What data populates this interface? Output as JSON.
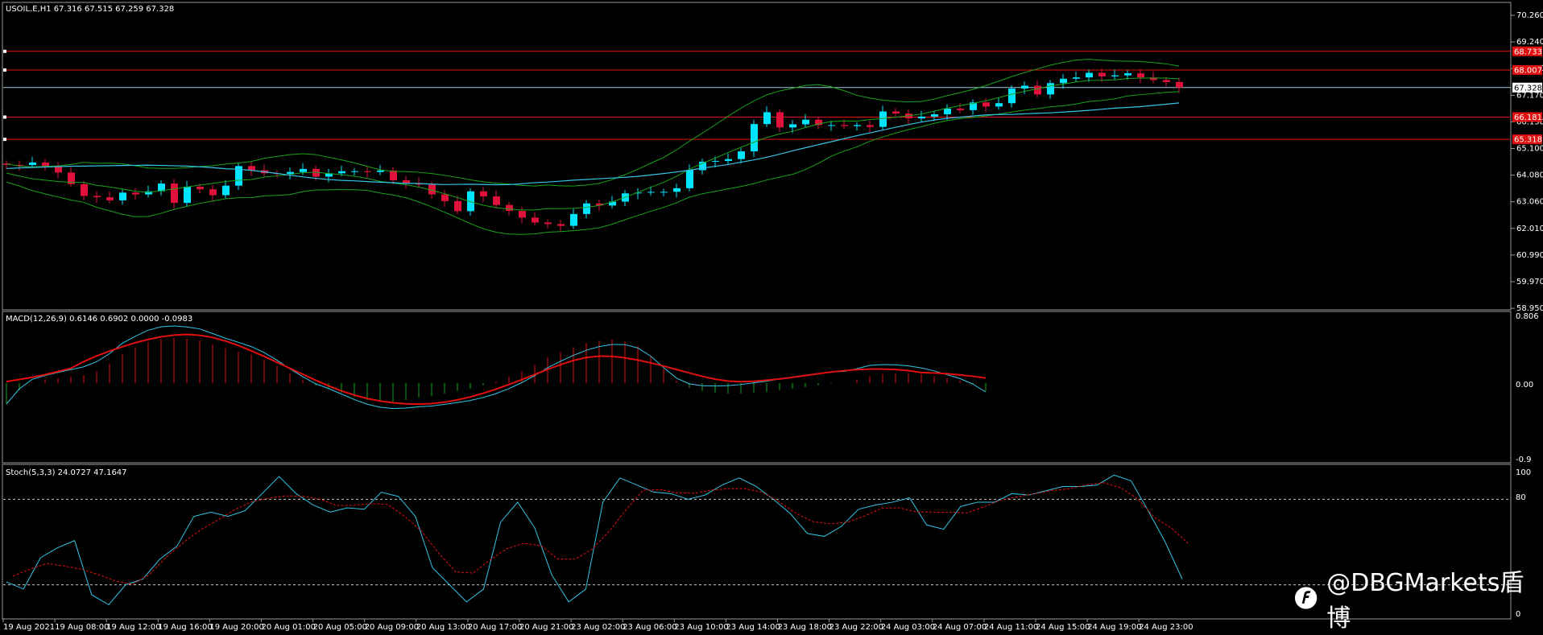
{
  "main": {
    "symbol_label": "USOIL.E,H1  67.316 67.515 67.259 67.328",
    "current_price": "67.328",
    "colors": {
      "bull": "#00e5ff",
      "bear": "#e0123c",
      "band": "#1aa31a",
      "ma": "#35c4e6",
      "hline": "#e01010",
      "bg": "#000000",
      "frame": "#9a9a9a"
    }
  },
  "macd": {
    "label": "MACD(12,26,9) 0.6146 0.6902 0.0000 -0.0983",
    "ticks": [
      "0.806",
      "0.00",
      "-0.9"
    ]
  },
  "stoch": {
    "label": "Stoch(5,3,3) 24.0727 47.1647",
    "ticks": [
      "100",
      "80",
      "0"
    ]
  },
  "watermark": {
    "icon": "dbg-logo-icon",
    "text": "@DBGMarkets盾博"
  },
  "chart_data": [
    {
      "type": "candlestick",
      "title": "USOIL.E,H1  67.316 67.515 67.259 67.328",
      "y_ticks": [
        "70.260",
        "69.240",
        "68.190",
        "67.170",
        "66.150",
        "65.100",
        "64.080",
        "63.060",
        "62.010",
        "60.990",
        "59.970",
        "58.950"
      ],
      "ylim": [
        58.7,
        70.6
      ],
      "x_tick_labels": [
        "19 Aug 2021",
        "19 Aug 08:00",
        "19 Aug 12:00",
        "19 Aug 16:00",
        "19 Aug 20:00",
        "20 Aug 01:00",
        "20 Aug 05:00",
        "20 Aug 09:00",
        "20 Aug 13:00",
        "20 Aug 17:00",
        "20 Aug 21:00",
        "23 Aug 02:00",
        "23 Aug 06:00",
        "23 Aug 10:00",
        "23 Aug 14:00",
        "23 Aug 18:00",
        "23 Aug 22:00",
        "24 Aug 03:00",
        "24 Aug 07:00",
        "24 Aug 11:00",
        "24 Aug 15:00",
        "24 Aug 19:00",
        "24 Aug 23:00"
      ],
      "horizontal_levels": [
        {
          "price": 68.733,
          "label": "68.733"
        },
        {
          "price": 68.007,
          "label": "68.007"
        },
        {
          "price": 66.181,
          "label": "66.181"
        },
        {
          "price": 65.318,
          "label": "65.318"
        }
      ],
      "current_price_line": 67.328,
      "close": [
        64.33,
        64.32,
        64.42,
        64.27,
        64.03,
        63.58,
        63.12,
        63.07,
        62.95,
        63.25,
        63.18,
        63.3,
        63.6,
        62.85,
        63.48,
        63.38,
        63.15,
        63.52,
        64.28,
        64.12,
        64.0,
        63.98,
        64.05,
        64.17,
        63.87,
        64.0,
        64.08,
        64.08,
        64.05,
        64.11,
        63.73,
        63.62,
        63.56,
        63.18,
        62.92,
        62.53,
        63.3,
        63.1,
        62.77,
        62.54,
        62.28,
        62.09,
        62.03,
        61.96,
        62.42,
        62.83,
        62.75,
        62.9,
        63.22,
        63.25,
        63.28,
        63.28,
        63.42,
        64.12,
        64.45,
        64.48,
        64.55,
        64.85,
        65.91,
        66.37,
        65.78,
        65.9,
        66.08,
        65.87,
        65.87,
        65.83,
        65.87,
        65.8,
        66.4,
        66.32,
        66.13,
        66.2,
        66.29,
        66.51,
        66.45,
        66.75,
        66.59,
        66.72,
        67.29,
        67.4,
        67.06,
        67.5,
        67.67,
        67.72,
        67.9,
        67.76,
        67.8,
        67.88,
        67.72,
        67.62,
        67.54,
        67.33
      ],
      "bollinger": {
        "upper_start": 67.4,
        "upper_end": 68.1,
        "mid_start": 66.5,
        "mid_end": 67.0,
        "lower_start": 65.8,
        "lower_end": 65.9
      },
      "moving_average_note": "slow MA",
      "ma_range": [
        66.3,
        65.0
      ]
    },
    {
      "type": "bar+line",
      "title": "MACD(12,26,9) 0.6146 0.6902 0.0000 -0.0983",
      "ylim": [
        -1.0,
        0.88
      ],
      "series": [
        {
          "name": "MACD",
          "values": [
            -0.26,
            -0.09,
            0.01,
            0.04,
            0.06,
            0.08,
            0.1,
            0.15,
            0.24,
            0.36,
            0.44,
            0.51,
            0.55,
            0.56,
            0.55,
            0.53,
            0.48,
            0.43,
            0.39,
            0.35,
            0.29,
            0.21,
            0.12,
            0.04,
            -0.03,
            -0.07,
            -0.12,
            -0.17,
            -0.21,
            -0.23,
            -0.23,
            -0.21,
            -0.18,
            -0.16,
            -0.13,
            -0.1,
            -0.07,
            -0.03,
            0.02,
            0.08,
            0.15,
            0.23,
            0.32,
            0.39,
            0.45,
            0.5,
            0.53,
            0.54,
            0.52,
            0.46,
            0.34,
            0.18,
            0.03,
            -0.06,
            -0.1,
            -0.12,
            -0.13,
            -0.13,
            -0.12,
            -0.11,
            -0.09,
            -0.07,
            -0.05,
            -0.03,
            -0.01,
            0.0,
            0.04,
            0.09,
            0.11,
            0.12,
            0.12,
            0.11,
            0.09,
            0.06,
            0.03,
            -0.02,
            -0.1
          ]
        },
        {
          "name": "MACD Signal",
          "values": []
        }
      ]
    },
    {
      "type": "line",
      "title": "Stoch(5,3,3) 24.0727 47.1647",
      "ylim": [
        0,
        100
      ],
      "levels": [
        80,
        20
      ],
      "series": [
        {
          "name": "%K",
          "values": [
            22,
            17,
            39,
            46,
            51,
            13,
            6,
            20,
            24,
            38,
            47,
            68,
            71,
            68,
            72,
            84,
            96,
            84,
            76,
            71,
            74,
            73,
            85,
            82,
            68,
            32,
            20,
            8,
            17,
            64,
            78,
            60,
            27,
            8,
            17,
            78,
            95,
            90,
            85,
            84,
            80,
            83,
            90,
            95,
            89,
            80,
            70,
            56,
            54,
            61,
            73,
            76,
            78,
            81,
            62,
            59,
            75,
            78,
            78,
            84,
            83,
            86,
            89,
            89,
            90,
            97,
            93,
            72,
            50,
            24
          ]
        },
        {
          "name": "%D",
          "values": []
        }
      ]
    }
  ]
}
